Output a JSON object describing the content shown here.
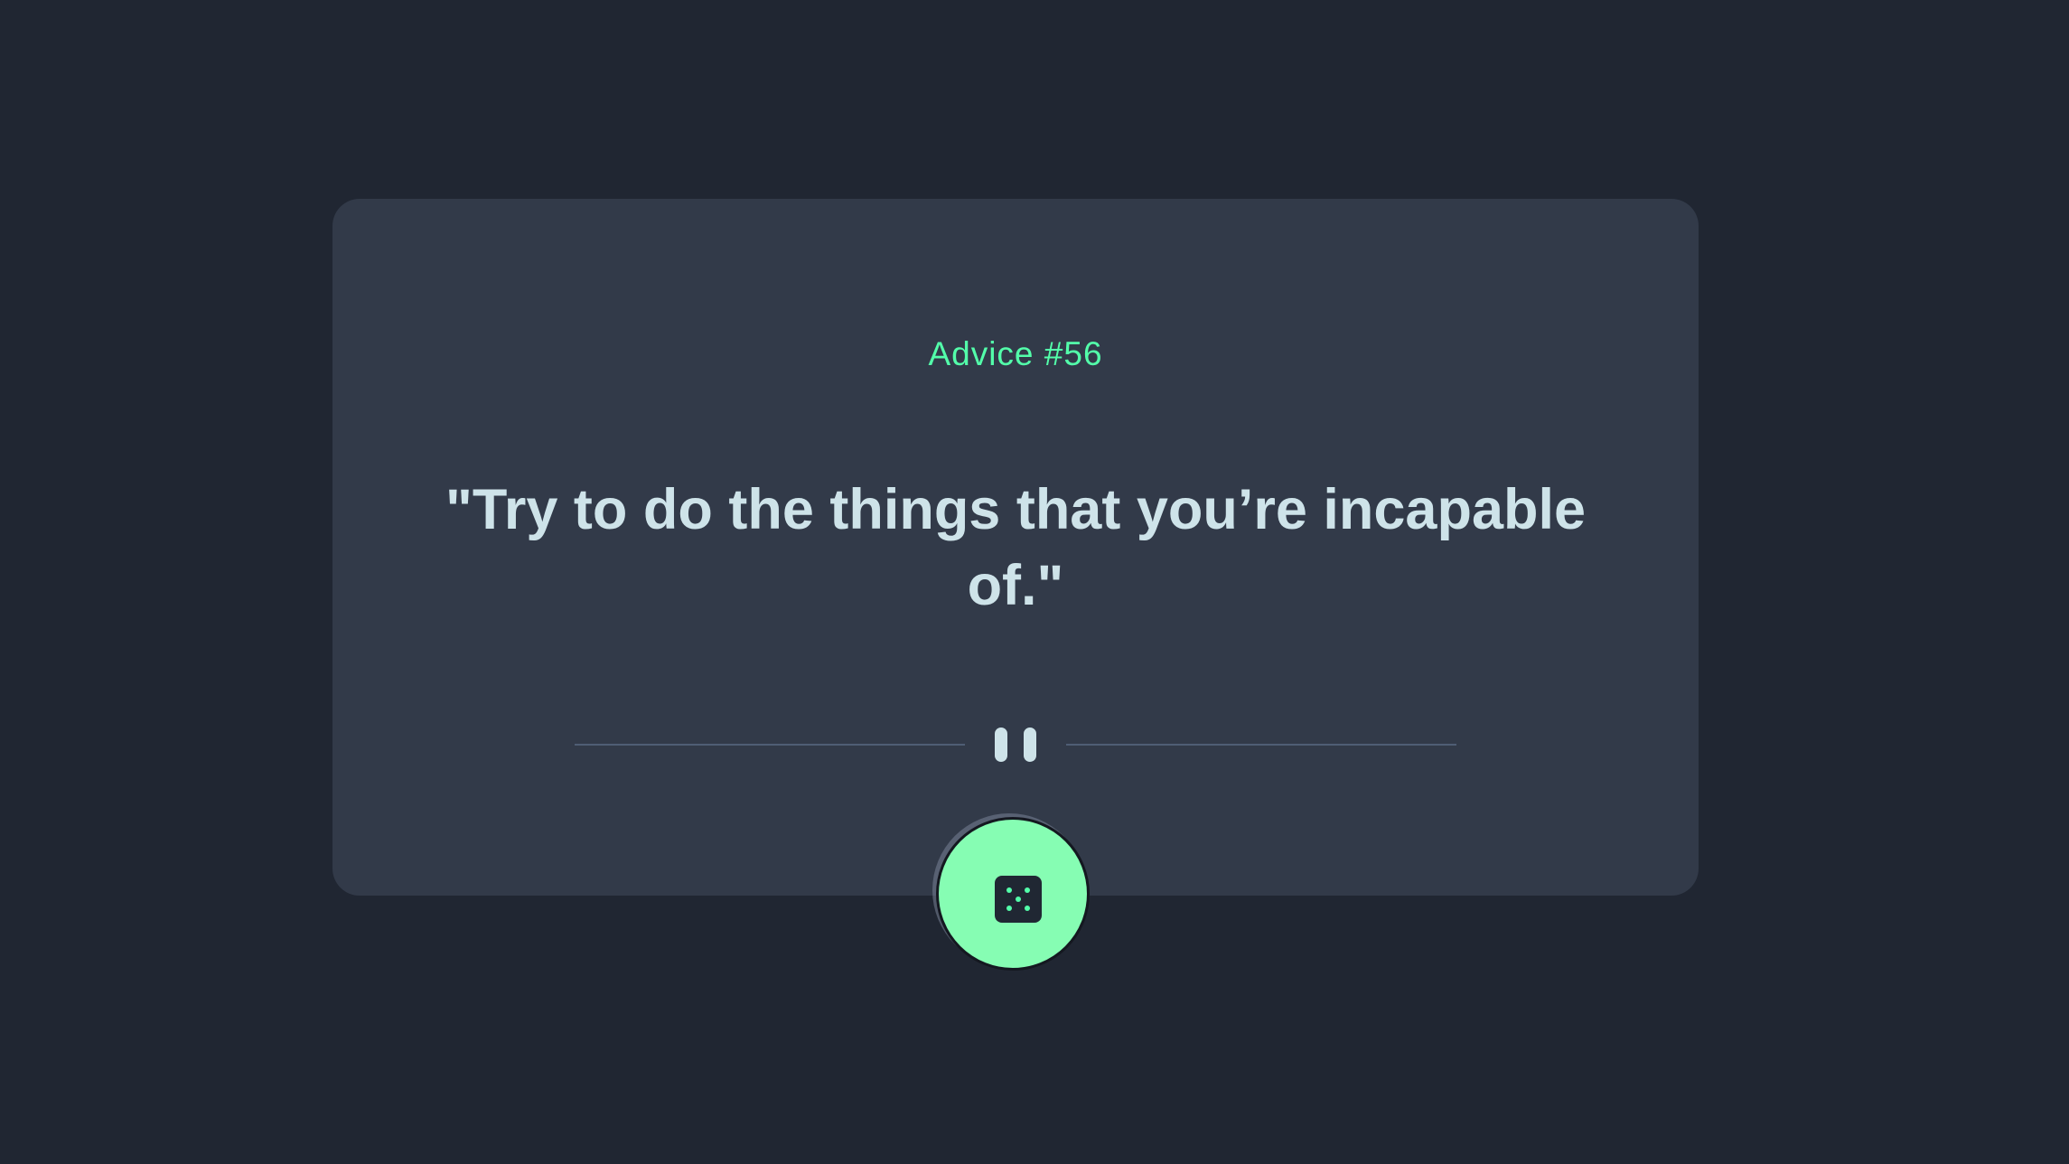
{
  "advice": {
    "label": "Advice #56",
    "quote": "\"Try to do the things that you’re incapable of.\""
  },
  "divider": {
    "icon": "pause-icon"
  },
  "button": {
    "icon": "dice-icon"
  },
  "colors": {
    "background": "#202632",
    "card": "#323a49",
    "accent": "#53ffaa",
    "button": "#86fdb3",
    "text": "#cee3e9",
    "divider_line": "#4f5d74"
  }
}
